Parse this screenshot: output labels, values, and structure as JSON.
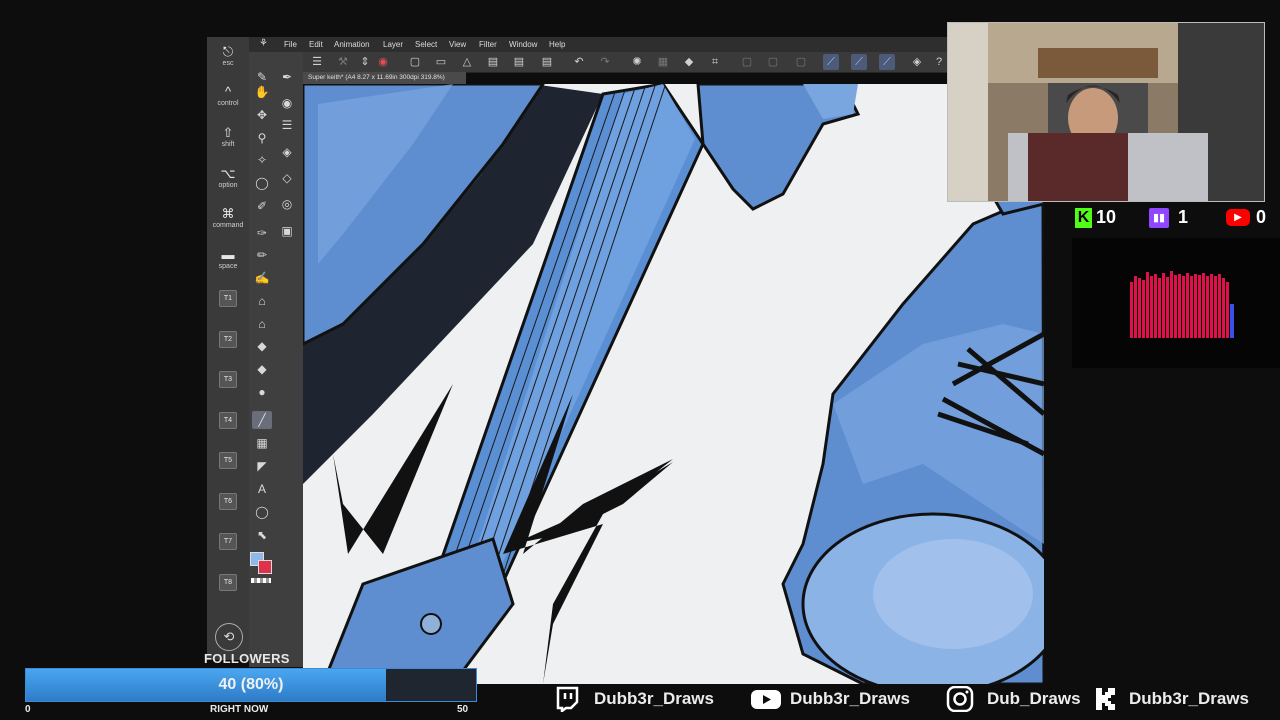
{
  "shortcut_keys": [
    {
      "glyph": "⎋",
      "label": "esc"
    },
    {
      "glyph": "^",
      "label": "control"
    },
    {
      "glyph": "⇧",
      "label": "shift"
    },
    {
      "glyph": "⌥",
      "label": "option"
    },
    {
      "glyph": "⌘",
      "label": "command"
    },
    {
      "glyph": "▬",
      "label": "space"
    }
  ],
  "tool_keys": [
    "T1",
    "T2",
    "T3",
    "T4",
    "T5",
    "T6",
    "T7",
    "T8"
  ],
  "menu": [
    "File",
    "Edit",
    "Animation",
    "Layer",
    "Select",
    "View",
    "Filter",
    "Window",
    "Help"
  ],
  "document_tab": "Super keith* (A4 8.27 x 11.69in 300dpi 319.8%)",
  "colors": {
    "main": "#8fb8e8",
    "sub": "#e0304a",
    "art_blue": "#5f8ed0",
    "accent": "#3d8ad8"
  },
  "counters": {
    "kick": "10",
    "twitch": "1",
    "youtube": "0"
  },
  "followers": {
    "label": "FOLLOWERS",
    "value_text": "40 (80%)",
    "progress": 0.8,
    "min": "0",
    "mid": "RIGHT NOW",
    "max": "50"
  },
  "socials": [
    {
      "icon": "twitch-icon",
      "handle": "Dubb3r_Draws"
    },
    {
      "icon": "youtube-icon",
      "handle": "Dubb3r_Draws"
    },
    {
      "icon": "instagram-icon",
      "handle": "Dub_Draws"
    },
    {
      "icon": "kick-icon",
      "handle": "Dubb3r_Draws"
    }
  ]
}
